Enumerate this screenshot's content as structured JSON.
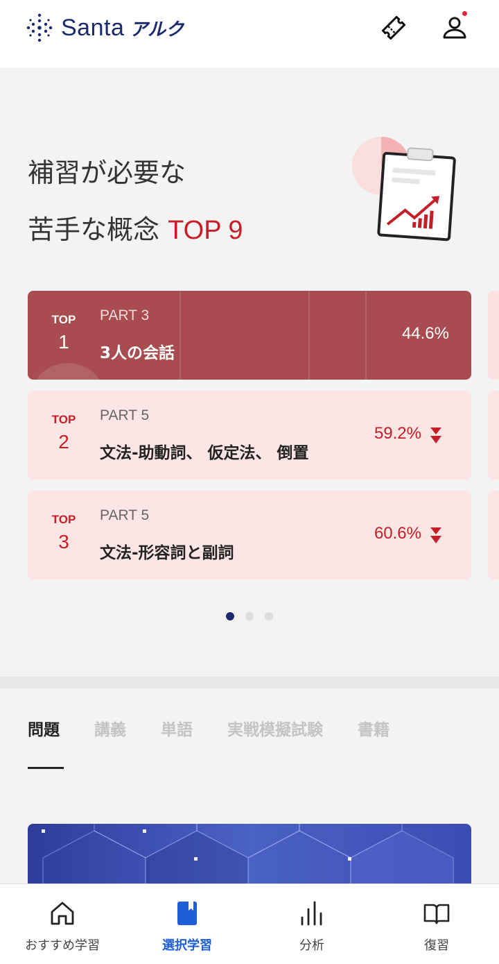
{
  "header": {
    "logo_brand": "Santa",
    "logo_partner": "アルク",
    "icons": [
      "ticket-icon",
      "user-icon"
    ]
  },
  "hero": {
    "title_line1": "補習が必要な",
    "title_line2_prefix": "苦手な概念",
    "title_line2_accent": "TOP 9"
  },
  "cards": [
    {
      "rank_label": "TOP",
      "rank": "1",
      "part": "PART 3",
      "name": "3人の会話",
      "percent": "44.6%"
    },
    {
      "rank_label": "TOP",
      "rank": "2",
      "part": "PART 5",
      "name": "文法-助動詞、 仮定法、 倒置",
      "percent": "59.2%",
      "trend_icon": "double-chevron-down-icon"
    },
    {
      "rank_label": "TOP",
      "rank": "3",
      "part": "PART 5",
      "name": "文法-形容詞と副詞",
      "percent": "60.6%",
      "trend_icon": "double-chevron-down-icon"
    }
  ],
  "pagination": {
    "total": 3,
    "active": 1
  },
  "tabs": [
    {
      "label": "問題",
      "active": true
    },
    {
      "label": "講義"
    },
    {
      "label": "単語"
    },
    {
      "label": "実戦模擬試験"
    },
    {
      "label": "書籍"
    }
  ],
  "bottom_nav": [
    {
      "label": "おすすめ学習",
      "icon": "home-icon"
    },
    {
      "label": "選択学習",
      "icon": "book-icon",
      "active": true
    },
    {
      "label": "分析",
      "icon": "bar-chart-icon"
    },
    {
      "label": "復習",
      "icon": "open-book-icon"
    }
  ],
  "colors": {
    "brand_navy": "#1a2a6c",
    "accent_red": "#c41f27",
    "card_top": "#a84c4f",
    "card_other": "#fce5e5",
    "nav_active": "#1e5fd8"
  }
}
